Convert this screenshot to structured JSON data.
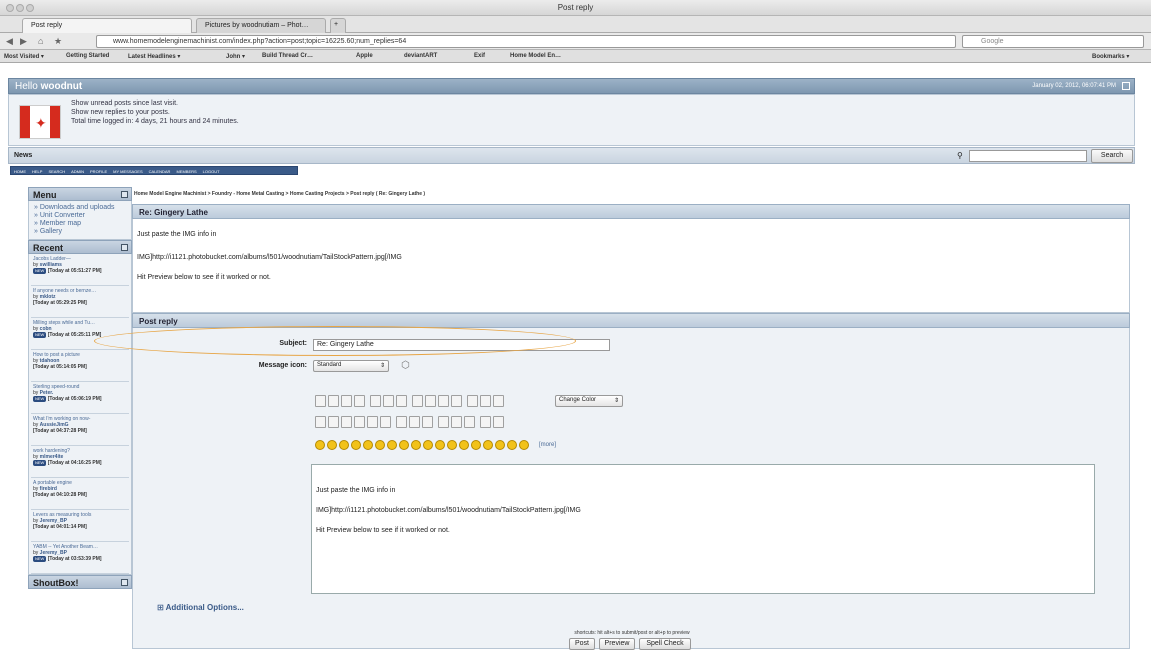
{
  "window": {
    "title": "Post reply"
  },
  "tabs": [
    {
      "label": "Post reply",
      "active": true
    },
    {
      "label": "Pictures by woodnutiam – Phot…",
      "active": false
    }
  ],
  "browser": {
    "url": "www.homemodelenginemachinist.com/index.php?action=post;topic=16225.60;num_replies=64",
    "search_placeholder": "Google"
  },
  "bookmarks": [
    "Most Visited ▾",
    "Getting Started",
    "Latest Headlines ▾",
    "John ▾",
    "Build Thread Cr…",
    "Apple",
    "deviantART",
    "Exif",
    "Home Model En…"
  ],
  "bookmarks_right": "Bookmarks ▾",
  "header": {
    "greeting": "Hello",
    "username": "woodnut",
    "date": "January 02, 2012, 06:07:41 PM",
    "links": [
      "Show unread posts since last visit.",
      "Show new replies to your posts.",
      "Total time logged in: 4 days, 21 hours and 24 minutes."
    ]
  },
  "newsbar": {
    "label": "News",
    "search_button": "Search"
  },
  "topmenu": [
    "HOME",
    "HELP",
    "SEARCH",
    "ADMIN",
    "PROFILE",
    "MY MESSAGES",
    "CALENDAR",
    "MEMBERS",
    "LOGOUT"
  ],
  "sidebar": {
    "menu_title": "Menu",
    "menu_items": [
      "» Downloads and uploads",
      "» Unit Converter",
      "» Member map",
      "» Gallery"
    ],
    "recent_title": "Recent",
    "recent": [
      {
        "title": "Jacobs Ladder—",
        "author": "swilliams",
        "time": "[Today at 05:51:27 PM]",
        "new": true
      },
      {
        "title": "If anyone needs or bernze…",
        "author": "mklotz",
        "time": "[Today at 05:29:25 PM]",
        "new": false
      },
      {
        "title": "Milling steps while and Tu…",
        "author": "cobn",
        "time": "[Today at 05:25:11 PM]",
        "new": true
      },
      {
        "title": "How to post a picture",
        "author": "tdahoon",
        "time": "[Today at 05:14:05 PM]",
        "new": false
      },
      {
        "title": "Sterling speed-round",
        "author": "Peter.",
        "time": "[Today at 05:06:19 PM]",
        "new": true
      },
      {
        "title": "What I'm working on now-",
        "author": "AussieJimG",
        "time": "[Today at 04:37:28 PM]",
        "new": false
      },
      {
        "title": "work hardening?",
        "author": "mlmer4ite",
        "time": "[Today at 04:16:25 PM]",
        "new": true
      },
      {
        "title": "A portable engine",
        "author": "firebird",
        "time": "[Today at 04:10:28 PM]",
        "new": false
      },
      {
        "title": "Levers as measuring tools",
        "author": "Jeremy_BP",
        "time": "[Today at 04:01:14 PM]",
        "new": false
      },
      {
        "title": "YABM -- Yet Another Beam…",
        "author": "Jeremy_BP",
        "time": "[Today at 03:53:39 PM]",
        "new": true
      }
    ],
    "shoutbox_title": "ShoutBox!",
    "new_badge": "NEW"
  },
  "main": {
    "breadcrumb": "Home Model Engine Machinist > Foundry - Home Metal Casting > Home Casting Projects > Post reply ( Re: Gingery Lathe )",
    "preview_title": "Re: Gingery Lathe",
    "preview_lines": [
      "Just paste the IMG info in",
      "IMG]http://i1121.photobucket.com/albums/l501/woodnutiam/TailStockPattern.jpg[/IMG",
      "Hit Preview below to see if it worked or not."
    ],
    "post_title": "Post reply",
    "subject_label": "Subject:",
    "subject_value": "Re: Gingery Lathe",
    "icon_label": "Message icon:",
    "icon_value": "Standard",
    "change_color": "Change Color",
    "more": "[more]",
    "message_lines": [
      "Just paste the IMG info in",
      "IMG]http://i1121.photobucket.com/albums/l501/woodnutiam/TailStockPattern.jpg[/IMG",
      "Hit Preview below to see if it worked or not."
    ],
    "additional_options": "Additional Options...",
    "shortcuts": "shortcuts: hit alt+s to submit/post or alt+p to preview",
    "buttons": [
      "Post",
      "Preview",
      "Spell Check"
    ]
  },
  "colors": {
    "accent": "#3a5a88",
    "highlight_oval": "#e7a545",
    "flag_red": "#d52b1e"
  }
}
